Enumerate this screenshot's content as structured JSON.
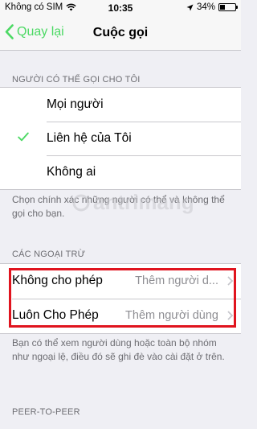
{
  "status_bar": {
    "carrier": "Không có SIM",
    "time": "10:35",
    "battery_percent": "34%",
    "battery_level": 0.34
  },
  "nav": {
    "back_label": "Quay lại",
    "title": "Cuộc gọi"
  },
  "allow_section": {
    "header": "NGƯỜI CÓ THỂ GỌI CHO TÔI",
    "options": [
      {
        "label": "Mọi người",
        "selected": false
      },
      {
        "label": "Liên hệ của Tôi",
        "selected": true
      },
      {
        "label": "Không ai",
        "selected": false
      }
    ],
    "footer": "Chọn chính xác những người có thể và không thể gọi cho bạn."
  },
  "exceptions_section": {
    "header": "CÁC NGOẠI TRỪ",
    "rows": [
      {
        "label": "Không cho phép",
        "value": "Thêm người d..."
      },
      {
        "label": "Luôn Cho Phép",
        "value": "Thêm người dùng"
      }
    ],
    "footer": "Bạn có thể xem người dùng hoặc toàn bộ nhóm như ngoại lệ, điều đó sẽ ghi đè vào cài đặt ở trên."
  },
  "peer_section": {
    "header": "PEER-TO-PEER"
  },
  "watermark": "antrimang",
  "colors": {
    "accent": "#4cd964",
    "highlight": "#e0141e",
    "background": "#efeff4"
  }
}
